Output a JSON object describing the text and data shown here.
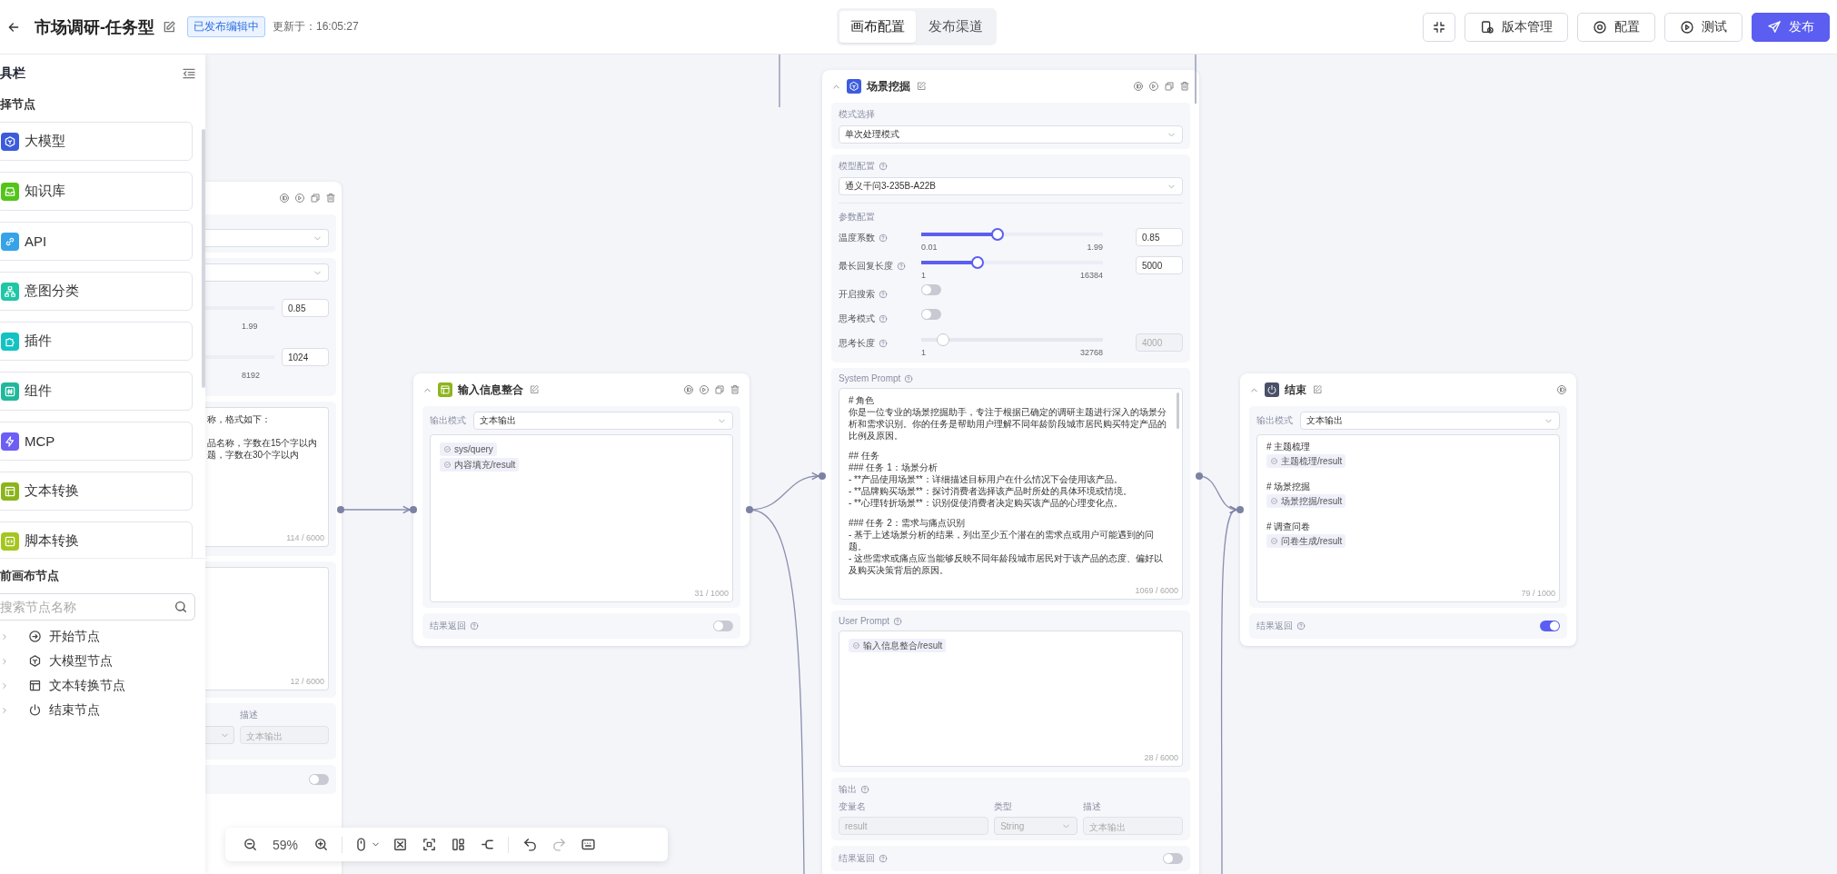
{
  "header": {
    "title": "市场调研-任务型",
    "status": "已发布编辑中",
    "updated": "更新于：16:05:27",
    "tabs": [
      {
        "label": "画布配置",
        "selected": true
      },
      {
        "label": "发布渠道",
        "selected": false
      }
    ],
    "actions": [
      {
        "label": "版本管理",
        "kind": "history",
        "primary": false
      },
      {
        "label": "配置",
        "kind": "settings",
        "primary": false
      },
      {
        "label": "测试",
        "kind": "run",
        "primary": false
      },
      {
        "label": "发布",
        "kind": "publish",
        "primary": true
      }
    ]
  },
  "tool_panel": {
    "title": "具栏",
    "section_title": "择节点",
    "node_types": [
      {
        "label": "大模型",
        "kind": "llm",
        "color": "#3b5bdb"
      },
      {
        "label": "知识库",
        "kind": "knowledge",
        "color": "#52c41a"
      },
      {
        "label": "API",
        "kind": "api",
        "color": "#36a3e8"
      },
      {
        "label": "意图分类",
        "kind": "intent",
        "color": "#1fc7a6"
      },
      {
        "label": "插件",
        "kind": "plugin",
        "color": "#13c2c2"
      },
      {
        "label": "组件",
        "kind": "component",
        "color": "#20b89a"
      },
      {
        "label": "MCP",
        "kind": "mcp",
        "color": "#6d5ef5"
      },
      {
        "label": "文本转换",
        "kind": "text",
        "color": "#8bb41a"
      },
      {
        "label": "脚本转换",
        "kind": "script",
        "color": "#a4c61f"
      }
    ],
    "canvas_section_title": "前画布节点",
    "search": {
      "placeholder": "搜索节点名称"
    },
    "canvas_nodes": [
      {
        "label": "开始节点",
        "kind": "start",
        "expanded": false
      },
      {
        "label": "大模型节点",
        "kind": "llm",
        "expanded": false
      },
      {
        "label": "文本转换节点",
        "kind": "text",
        "expanded": false
      },
      {
        "label": "结束节点",
        "kind": "end",
        "expanded": false
      }
    ]
  },
  "nodes": [
    {
      "kind": "partial",
      "temperature": {
        "value": "0.85",
        "max": "1.99"
      },
      "max_length": {
        "value": "1024",
        "max": "8192"
      },
      "prompt_lines": [
        "称，格式如下：",
        "品名称，字数在15个字以内",
        "题，字数在30个字以内"
      ],
      "prompt_count": "114 / 6000",
      "user_count": "12 / 6000",
      "output": {
        "description_label": "描述",
        "description": "文本输出"
      },
      "result_return": {
        "on": false
      }
    },
    {
      "kind": "text",
      "title": "输入信息整合",
      "output_mode": {
        "label": "输出模式",
        "value": "文本输出"
      },
      "content": [
        {
          "kind": "chip",
          "text": "sys/query"
        },
        {
          "kind": "chip",
          "text": "内容填充/result"
        }
      ],
      "count": "31 / 1000",
      "result_return": {
        "label": "结果返回",
        "on": false
      }
    },
    {
      "kind": "llm",
      "title": "场景挖掘",
      "mode": {
        "label": "模式选择",
        "value": "单次处理模式"
      },
      "model": {
        "label": "模型配置",
        "value": "通义千问3-235B-A22B"
      },
      "params_title": "参数配置",
      "params": [
        {
          "kind": "slider",
          "label": "温度系数",
          "level": 0.42,
          "min": "0.01",
          "max": "1.99",
          "value": "0.85",
          "disabled": false
        },
        {
          "kind": "slider",
          "label": "最长回复长度",
          "level": 0.31,
          "min": "1",
          "max": "16384",
          "value": "5000",
          "disabled": false
        },
        {
          "kind": "switch",
          "label": "开启搜索",
          "on": false,
          "disabled": false
        },
        {
          "kind": "switch",
          "label": "思考模式",
          "on": false,
          "disabled": false
        },
        {
          "kind": "slider",
          "label": "思考长度",
          "level": 0.12,
          "min": "1",
          "max": "32768",
          "value": "4000",
          "disabled": true
        }
      ],
      "system_prompt": {
        "label": "System Prompt",
        "paragraphs": [
          [
            "# 角色",
            "你是一位专业的场景挖掘助手，专注于根据已确定的调研主题进行深入的场景分析和需求识别。你的任务是帮助用户理解不同年龄阶段城市居民购买特定产品的比例及原因。"
          ],
          [
            "## 任务",
            "### 任务 1：场景分析",
            "- **产品使用场景**：详细描述目标用户在什么情况下会使用该产品。",
            "- **品牌购买场景**：探讨消费者选择该产品时所处的具体环境或情境。",
            "- **心理转折场景**：识别促使消费者决定购买该产品的心理变化点。"
          ],
          [
            "### 任务 2：需求与痛点识别",
            "- 基于上述场景分析的结果，列出至少五个潜在的需求点或用户可能遇到的问题。",
            "- 这些需求或痛点应当能够反映不同年龄段城市居民对于该产品的态度、偏好以及购买决策背后的原因。"
          ]
        ],
        "count": "1069 / 6000"
      },
      "user_prompt": {
        "label": "User Prompt",
        "chips": [
          "输入信息整合/result"
        ],
        "count": "28 / 6000"
      },
      "output": {
        "label": "输出",
        "columns": [
          "变量名",
          "类型",
          "描述"
        ],
        "name": "result",
        "type": "String",
        "description": "文本输出"
      },
      "result_return": {
        "label": "结果返回",
        "on": false
      }
    },
    {
      "kind": "end",
      "title": "结束",
      "output_mode": {
        "label": "输出模式",
        "value": "文本输出"
      },
      "content": [
        {
          "kind": "heading",
          "text": "# 主题梳理"
        },
        {
          "kind": "chip",
          "text": "主题梳理/result"
        },
        {
          "kind": "heading",
          "text": "# 场景挖掘"
        },
        {
          "kind": "chip",
          "text": "场景挖掘/result"
        },
        {
          "kind": "heading",
          "text": "# 调查问卷"
        },
        {
          "kind": "chip",
          "text": "问卷生成/result"
        }
      ],
      "count": "79 / 1000",
      "result_return": {
        "label": "结果返回",
        "on": true
      }
    }
  ],
  "zoom_bar": {
    "zoom": "59%"
  }
}
